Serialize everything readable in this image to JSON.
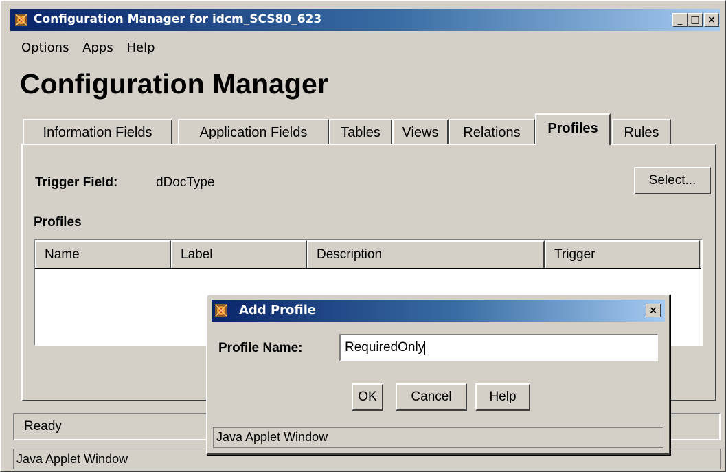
{
  "window": {
    "title": "Configuration Manager for idcm_SCS80_623",
    "controls": {
      "minimize": "_",
      "maximize": "□",
      "close": "×"
    }
  },
  "menu": [
    "Options",
    "Apps",
    "Help"
  ],
  "page_title": "Configuration Manager",
  "tabs": [
    {
      "label": "Information Fields"
    },
    {
      "label": "Application Fields"
    },
    {
      "label": "Tables"
    },
    {
      "label": "Views"
    },
    {
      "label": "Relations"
    },
    {
      "label": "Profiles",
      "active": true
    },
    {
      "label": "Rules"
    }
  ],
  "profiles_tab": {
    "trigger_label": "Trigger Field:",
    "trigger_value": "dDocType",
    "select_button": "Select...",
    "section_label": "Profiles",
    "columns": [
      "Name",
      "Label",
      "Description",
      "Trigger"
    ]
  },
  "status": "Ready",
  "applet_label": "Java Applet Window",
  "dialog": {
    "title": "Add Profile",
    "close": "×",
    "field_label": "Profile Name:",
    "field_value": "RequiredOnly",
    "buttons": {
      "ok": "OK",
      "cancel": "Cancel",
      "help": "Help"
    },
    "applet_label": "Java Applet Window"
  }
}
